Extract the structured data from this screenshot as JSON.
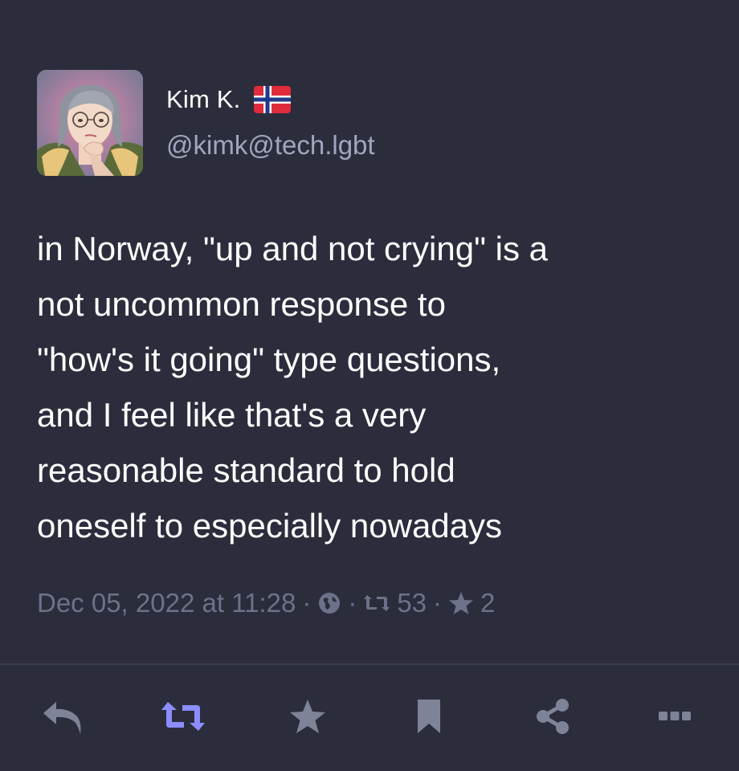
{
  "author": {
    "display_name": "Kim K.",
    "handle": "@kimk@tech.lgbt",
    "flag_icon": "norway-flag-icon",
    "avatar_icon": "avatar-illustration"
  },
  "post": {
    "lines": [
      "in Norway, \"up and not crying\" is a",
      "not uncommon response to",
      "\"how's it going\" type questions,",
      "and I feel like that's a very",
      "reasonable standard to hold",
      "oneself to especially nowadays"
    ]
  },
  "meta": {
    "timestamp": "Dec 05, 2022 at 11:28",
    "separator": "·",
    "visibility_icon": "globe-icon",
    "boost_count": "53",
    "favourite_count": "2"
  },
  "actions": [
    {
      "name": "reply-button",
      "icon": "reply-icon"
    },
    {
      "name": "boost-button",
      "icon": "boost-icon"
    },
    {
      "name": "favourite-button",
      "icon": "star-icon"
    },
    {
      "name": "bookmark-button",
      "icon": "bookmark-icon"
    },
    {
      "name": "share-button",
      "icon": "share-icon"
    },
    {
      "name": "more-button",
      "icon": "more-icon"
    }
  ],
  "colors": {
    "background": "#2b2d3c",
    "text": "#ffffff",
    "muted": "#6d728a",
    "handle": "#a0a6bd",
    "boost_accent": "#8c8dff",
    "action_icon": "#7e8398"
  }
}
